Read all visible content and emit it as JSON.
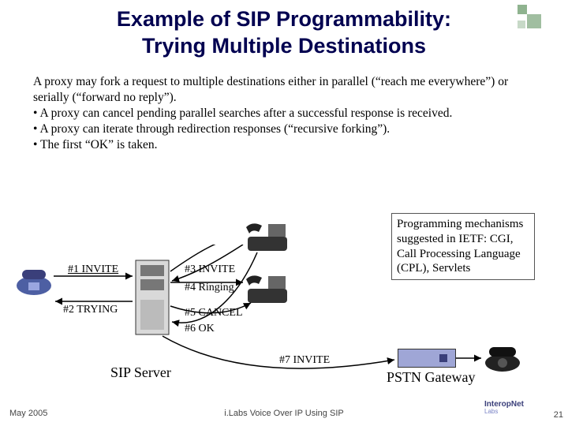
{
  "title_line1": "Example of SIP Programmability:",
  "title_line2": "Trying Multiple Destinations",
  "body": {
    "p1": "A proxy may fork a request to multiple destinations either in parallel (“reach me everywhere”) or serially (“forward no reply”).",
    "b1": "• A proxy can cancel pending parallel searches after a successful response is received.",
    "b2": "• A proxy can iterate through redirection responses (“recursive forking”).",
    "b3": "• The first “OK” is taken."
  },
  "callout": "Programming mechanisms suggested in IETF:  CGI, Call Processing Language (CPL), Servlets",
  "diagram": {
    "msg1": "#1 INVITE",
    "msg2": "#2 TRYING",
    "msg3": "#3 INVITE",
    "msg4": "#4 Ringing",
    "msg5": "#5 CANCEL",
    "msg6": "#6 OK",
    "msg7": "#7 INVITE",
    "server": "SIP Server",
    "gateway": "PSTN Gateway"
  },
  "footer": {
    "date": "May 2005",
    "center": "i.Labs Voice Over IP Using SIP",
    "page": "21",
    "logo1": "InteropNet",
    "logo2": "Labs"
  }
}
